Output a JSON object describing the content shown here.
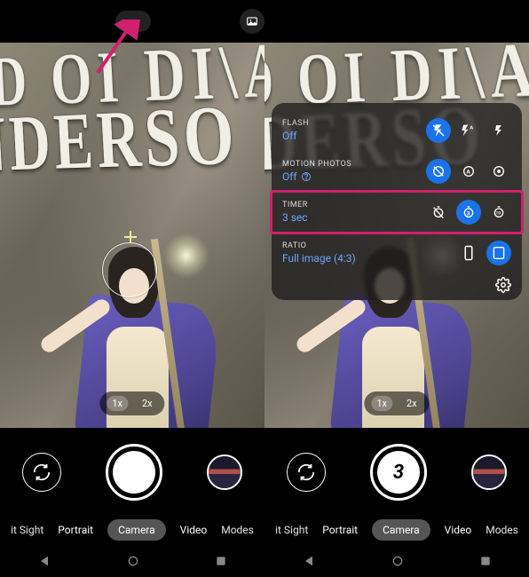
{
  "book": {
    "line1": "ID OI DI\\AINDUIN",
    "line2": "NDERSO"
  },
  "zoom": {
    "opt1": "1x",
    "opt2": "2x",
    "selected": "1x"
  },
  "shutter": {
    "countdown": "3"
  },
  "modes": {
    "edgeLeft": "it Sight",
    "m1": "Portrait",
    "m2": "Camera",
    "m3": "Video",
    "edgeRight": "Modes",
    "selected": "Camera"
  },
  "settings": {
    "flash": {
      "title": "FLASH",
      "value": "Off"
    },
    "motion": {
      "title": "MOTION PHOTOS",
      "value": "Off"
    },
    "timer": {
      "title": "TIMER",
      "value": "3 sec"
    },
    "ratio": {
      "title": "RATIO",
      "value": "Full image (4:3)"
    }
  }
}
